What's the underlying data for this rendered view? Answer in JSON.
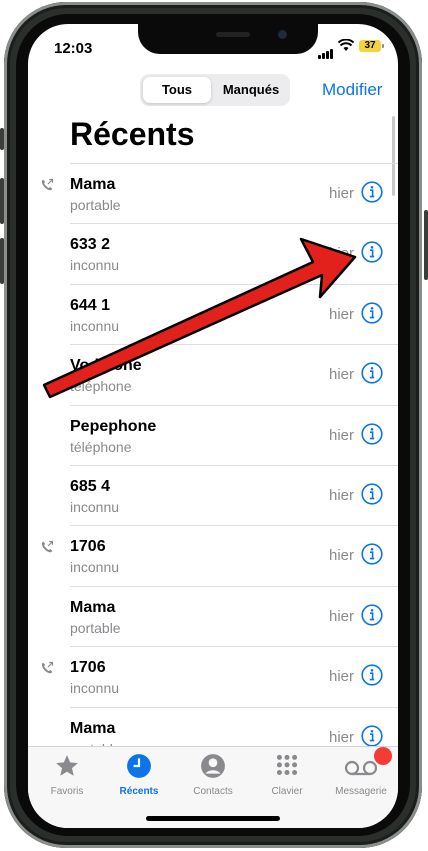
{
  "status": {
    "time": "12:03",
    "battery": "37"
  },
  "segmented": {
    "all": "Tous",
    "missed": "Manqués"
  },
  "header": {
    "edit": "Modifier",
    "title": "Récents"
  },
  "calls": [
    {
      "name": "Mama",
      "type": "portable",
      "when": "hier",
      "outgoing": true
    },
    {
      "name": "633 2",
      "type": "inconnu",
      "when": "hier",
      "outgoing": false
    },
    {
      "name": "644 1",
      "type": "inconnu",
      "when": "hier",
      "outgoing": false
    },
    {
      "name": "Vodafone",
      "type": "téléphone",
      "when": "hier",
      "outgoing": false
    },
    {
      "name": "Pepephone",
      "type": "téléphone",
      "when": "hier",
      "outgoing": false
    },
    {
      "name": "685 4",
      "type": "inconnu",
      "when": "hier",
      "outgoing": false
    },
    {
      "name": "1706",
      "type": "inconnu",
      "when": "hier",
      "outgoing": true
    },
    {
      "name": "Mama",
      "type": "portable",
      "when": "hier",
      "outgoing": false
    },
    {
      "name": "1706",
      "type": "inconnu",
      "when": "hier",
      "outgoing": true
    },
    {
      "name": "Mama",
      "type": "portable",
      "when": "hier",
      "outgoing": false
    }
  ],
  "tabs": [
    {
      "label": "Favoris",
      "icon": "star-icon"
    },
    {
      "label": "Récents",
      "icon": "clock-icon"
    },
    {
      "label": "Contacts",
      "icon": "person-icon"
    },
    {
      "label": "Clavier",
      "icon": "keypad-icon"
    },
    {
      "label": "Messagerie",
      "icon": "voicemail-icon"
    }
  ],
  "colors": {
    "accent": "#0a74e8",
    "badge": "#f33d34",
    "arrow": "#e3211c",
    "battery": "#f5d33c"
  }
}
